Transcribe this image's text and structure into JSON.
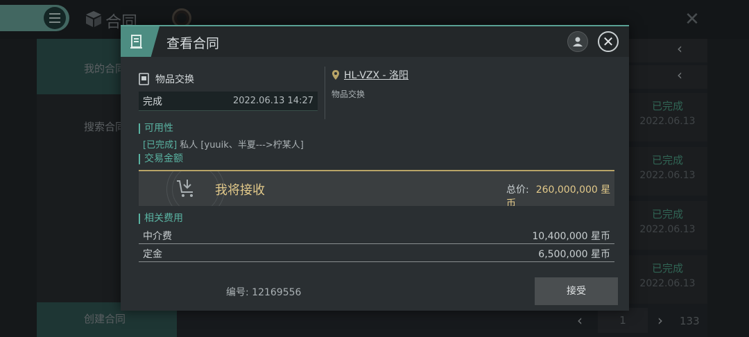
{
  "app": {
    "title": "合同"
  },
  "sidebar": {
    "items": [
      {
        "label": "我的合同"
      },
      {
        "label": "搜索合同"
      }
    ],
    "create_label": "创建合同"
  },
  "list": {
    "rows": [
      {
        "status": "已完成",
        "date": "2022.06.13"
      },
      {
        "status": "已完成",
        "date": "2022.06.13"
      },
      {
        "status": "已完成",
        "date": "2022.06.13"
      },
      {
        "status": "已完成",
        "date": "2022.06.13"
      }
    ],
    "status_color": "#4fae8e"
  },
  "pager": {
    "current": "1",
    "total": "133"
  },
  "modal": {
    "title": "查看合同",
    "contract_type": "物品交换",
    "status": "完成",
    "datetime": "2022.06.13 14:27",
    "location": "HL-VZX - 洛阳",
    "location_sub": "物品交换",
    "availability_title": "可用性",
    "availability_tag": "[已完成]",
    "availability_text": "私人 [yuuik、半夏--->柠某人]",
    "amount_title": "交易金额",
    "amount_label": "我将接收",
    "total_label": "总价:",
    "total_value": "260,000,000 星币",
    "fees_title": "相关费用",
    "fees": [
      {
        "label": "中介费",
        "value": "10,400,000 星币"
      },
      {
        "label": "定金",
        "value": "6,500,000 星币"
      }
    ],
    "contract_no_label": "编号:",
    "contract_no": "12169556",
    "accept_label": "接受",
    "accent_color": "#5ab3a2",
    "gold_color": "#e2c98a"
  },
  "icons": [
    "menu-icon",
    "cube-icon",
    "close-icon",
    "contract-icon",
    "user-icon",
    "item-exchange-icon",
    "location-pin-icon",
    "cart-download-icon",
    "chevron-left-icon",
    "chevron-right-icon"
  ]
}
